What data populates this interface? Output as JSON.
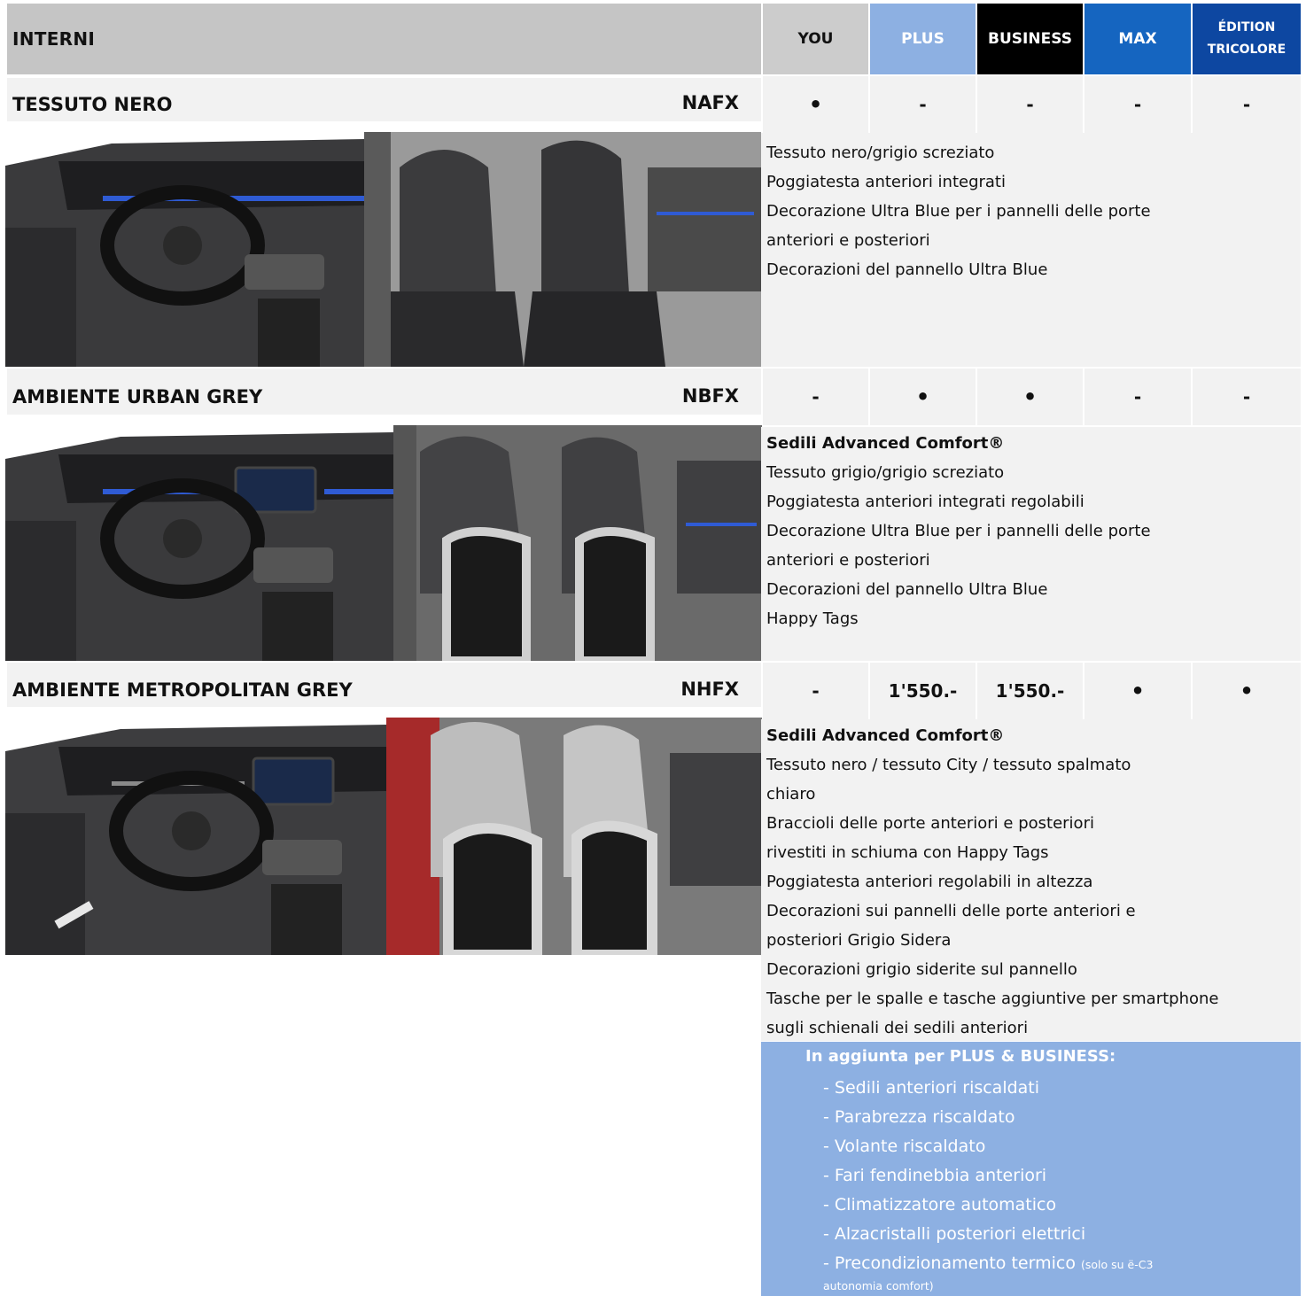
{
  "header": {
    "title": "INTERNI",
    "columns": [
      {
        "label": "YOU",
        "bg": "#cccccc",
        "color": "#111111"
      },
      {
        "label": "PLUS",
        "bg": "#8db0e2",
        "color": "#ffffff"
      },
      {
        "label": "BUSINESS",
        "bg": "#000000",
        "color": "#ffffff"
      },
      {
        "label": "MAX",
        "bg": "#1565c0",
        "color": "#ffffff"
      },
      {
        "label_line1": "ÉDITION",
        "label_line2": "TRICOLORE",
        "bg": "#0d47a1",
        "color": "#ffffff"
      }
    ]
  },
  "sections": [
    {
      "name": "TESSUTO NERO",
      "code": "NAFX",
      "cells": [
        "•",
        "-",
        "-",
        "-",
        "-"
      ],
      "description": [
        "Tessuto nero/grigio screziato",
        "Poggiatesta anteriori integrati",
        "Decorazione Ultra Blue per i pannelli delle porte",
        "anteriori e posteriori",
        "Decorazioni del pannello Ultra Blue"
      ]
    },
    {
      "name": "AMBIENTE URBAN GREY",
      "code": "NBFX",
      "cells": [
        "-",
        "•",
        "•",
        "-",
        "-"
      ],
      "description_bold": "Sedili Advanced Comfort®",
      "description": [
        "Tessuto grigio/grigio screziato",
        "Poggiatesta anteriori integrati regolabili",
        "Decorazione Ultra Blue per i pannelli delle porte",
        "anteriori e posteriori",
        "Decorazioni del pannello Ultra Blue",
        "Happy Tags"
      ]
    },
    {
      "name": "AMBIENTE METROPOLITAN GREY",
      "code": "NHFX",
      "cells": [
        "-",
        "1'550.-",
        "1'550.-",
        "•",
        "•"
      ],
      "description_bold": "Sedili Advanced Comfort®",
      "description": [
        "Tessuto nero / tessuto City / tessuto spalmato",
        "chiaro",
        "Braccioli delle porte anteriori e posteriori",
        "rivestiti in schiuma con Happy Tags",
        "Poggiatesta anteriori regolabili in altezza",
        "Decorazioni sui pannelli delle porte anteriori e",
        "posteriori Grigio Sidera",
        "Decorazioni grigio siderite sul pannello",
        "Tasche per le spalle e tasche aggiuntive per smartphone",
        "sugli schienali dei sedili anteriori"
      ]
    }
  ],
  "extra": {
    "title": "In aggiunta per PLUS & BUSINESS:",
    "items": [
      "- Sedili anteriori riscaldati",
      "- Parabrezza riscaldato",
      "- Volante riscaldato",
      "- Fari fendinebbia anteriori",
      "- Climatizzatore automatico",
      "- Alzacristalli posteriori elettrici",
      "- Precondizionamento termico"
    ],
    "note_part1": "(solo su ë-C3",
    "note_part2": "autonomia comfort)"
  }
}
